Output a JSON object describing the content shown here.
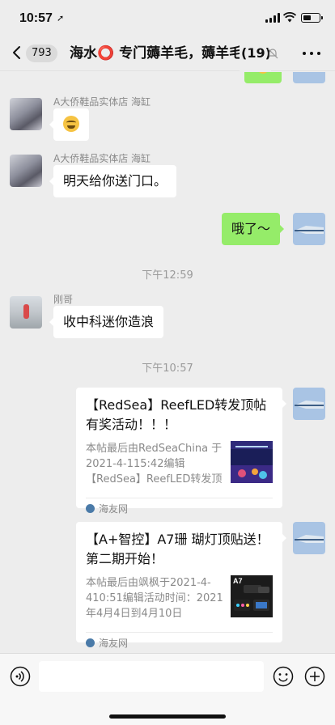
{
  "status_bar": {
    "time": "10:57",
    "location_arrow": "➚"
  },
  "nav": {
    "unread_badge": "793",
    "title": "海水⭕ 专门薅羊毛，薅羊毛群",
    "member_count": "(19)",
    "icons": [
      "back-chevron-icon",
      "mute-bell-icon",
      "more-icon"
    ]
  },
  "messages": [
    {
      "sender": "A大侨鞋品实体店 海缸",
      "type": "emoji"
    },
    {
      "sender": "A大侨鞋品实体店 海缸",
      "text": "明天给你送门口。"
    },
    {
      "sender": "me",
      "text": "哦了～"
    }
  ],
  "timestamps": [
    "下午12:59",
    "下午10:57"
  ],
  "gang_message": {
    "sender": "刚哥",
    "text": "收中科迷你造浪"
  },
  "cards": [
    {
      "title": "【RedSea】ReefLED转发顶帖有奖活动！！！",
      "description": "本帖最后由RedSeaChina 于2021-4-115:42编辑【RedSea】ReefLED转发顶帖有奖活动",
      "source": "海友网",
      "thumb_label": ""
    },
    {
      "title": "【A+智控】A7珊 瑚灯顶贴送！第二期开始！",
      "description": "本帖最后由飒枫于2021-4-410:51编辑活动时间：2021年4月4日到4月10日",
      "source": "海友网",
      "thumb_label": "A7"
    }
  ],
  "input": {
    "placeholder": "",
    "icons": [
      "voice-icon",
      "emoji-icon",
      "plus-icon"
    ]
  },
  "colors": {
    "background": "#ededed",
    "my_bubble": "#95ec69",
    "their_bubble": "#ffffff"
  }
}
